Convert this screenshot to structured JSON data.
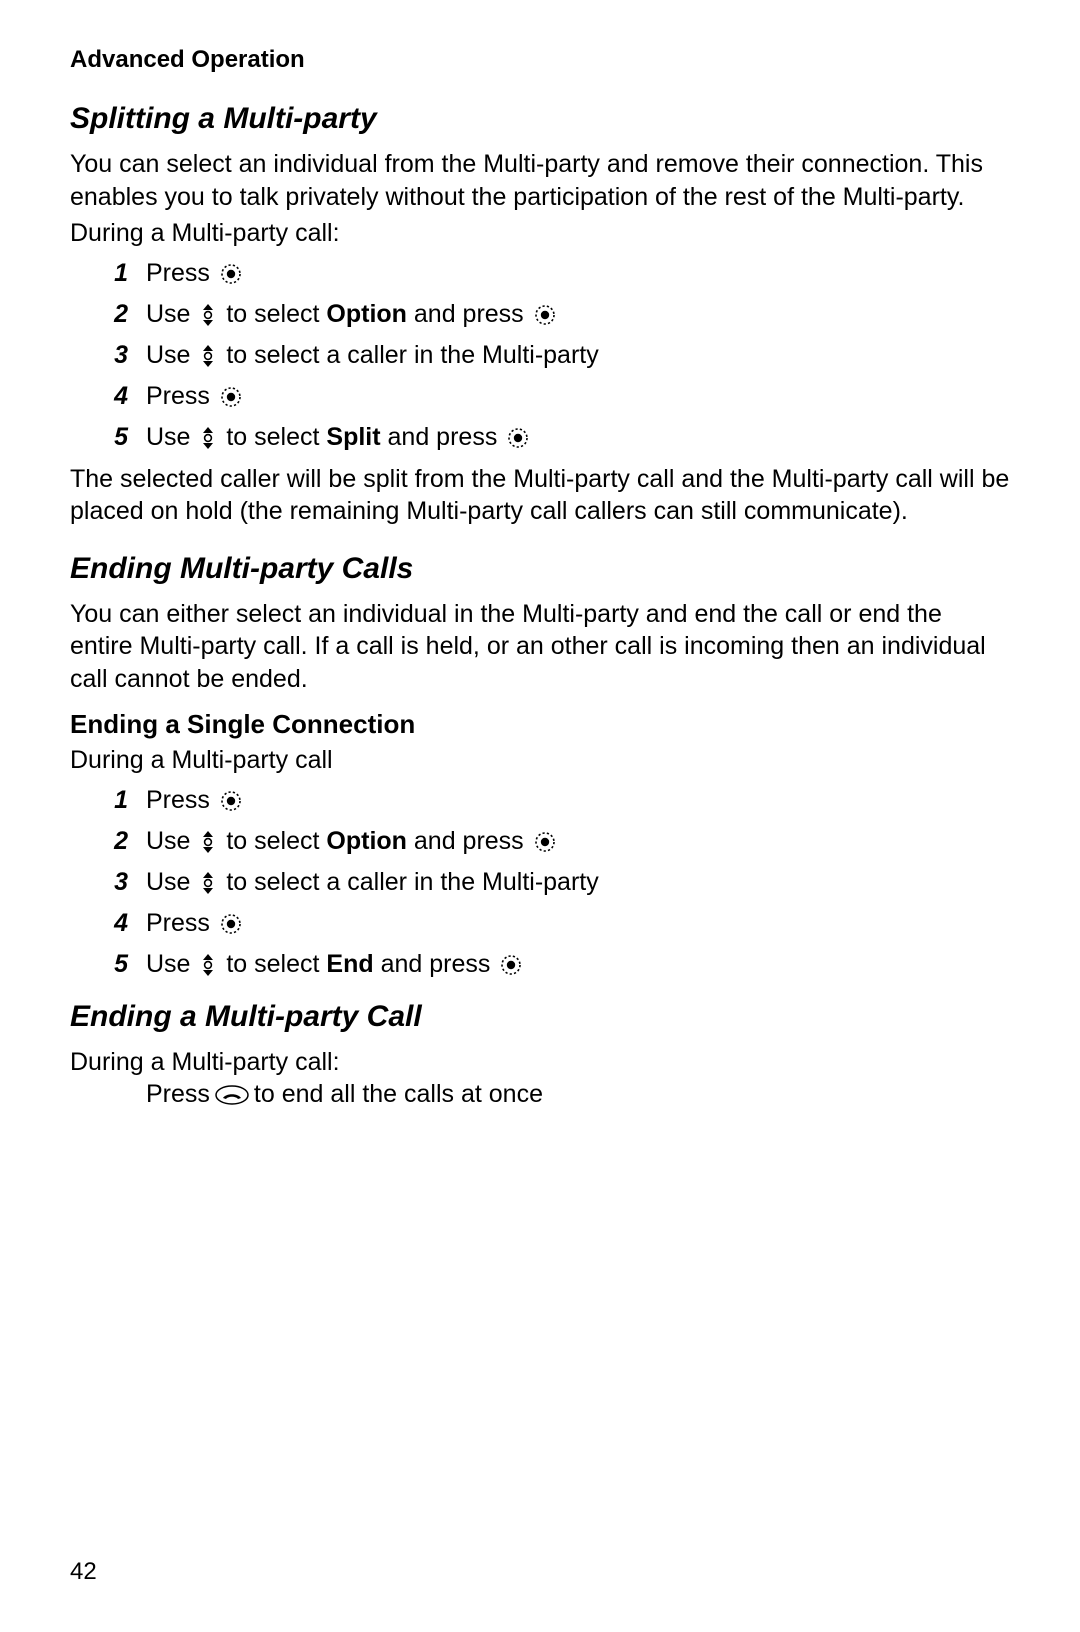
{
  "header": "Advanced Operation",
  "page_number": "42",
  "sections": {
    "split": {
      "title": "Splitting a Multi-party",
      "intro": "You can select an individual from the Multi-party and remove their connection. This enables you to talk privately without the participation of the rest of the Multi-party.",
      "lead": "During a Multi-party call:",
      "steps": {
        "n1": "1",
        "n2": "2",
        "n3": "3",
        "n4": "4",
        "n5": "5",
        "s1": "Press ",
        "s2a": "Use ",
        "s2b": " to select ",
        "s2bold": "Option",
        "s2c": " and press ",
        "s3a": "Use ",
        "s3b": " to select a caller in the Multi-party",
        "s4": "Press ",
        "s5a": "Use ",
        "s5b": " to select ",
        "s5bold": "Split",
        "s5c": " and press "
      },
      "tail": "The selected caller will be split from the Multi-party call and the Multi-party call will be placed on hold (the remaining Multi-party call callers can still communicate)."
    },
    "endMulti": {
      "title": "Ending Multi-party Calls",
      "intro": "You can either select an individual in the Multi-party and end the call or end the entire Multi-party call. If a call is held, or an other call is incoming then an individual call cannot be ended."
    },
    "endSingle": {
      "title": "Ending a Single Connection",
      "lead": "During a Multi-party call",
      "steps": {
        "n1": "1",
        "n2": "2",
        "n3": "3",
        "n4": "4",
        "n5": "5",
        "s1": "Press ",
        "s2a": "Use ",
        "s2b": " to select ",
        "s2bold": "Option",
        "s2c": " and press ",
        "s3a": "Use ",
        "s3b": " to select a caller in the Multi-party",
        "s4": "Press ",
        "s5a": "Use ",
        "s5b": " to select ",
        "s5bold": "End",
        "s5c": " and press "
      }
    },
    "endAll": {
      "title": "Ending a Multi-party Call",
      "lead": "During a Multi-party call:",
      "linea": "Press ",
      "lineb": " to end all the calls at once"
    }
  }
}
